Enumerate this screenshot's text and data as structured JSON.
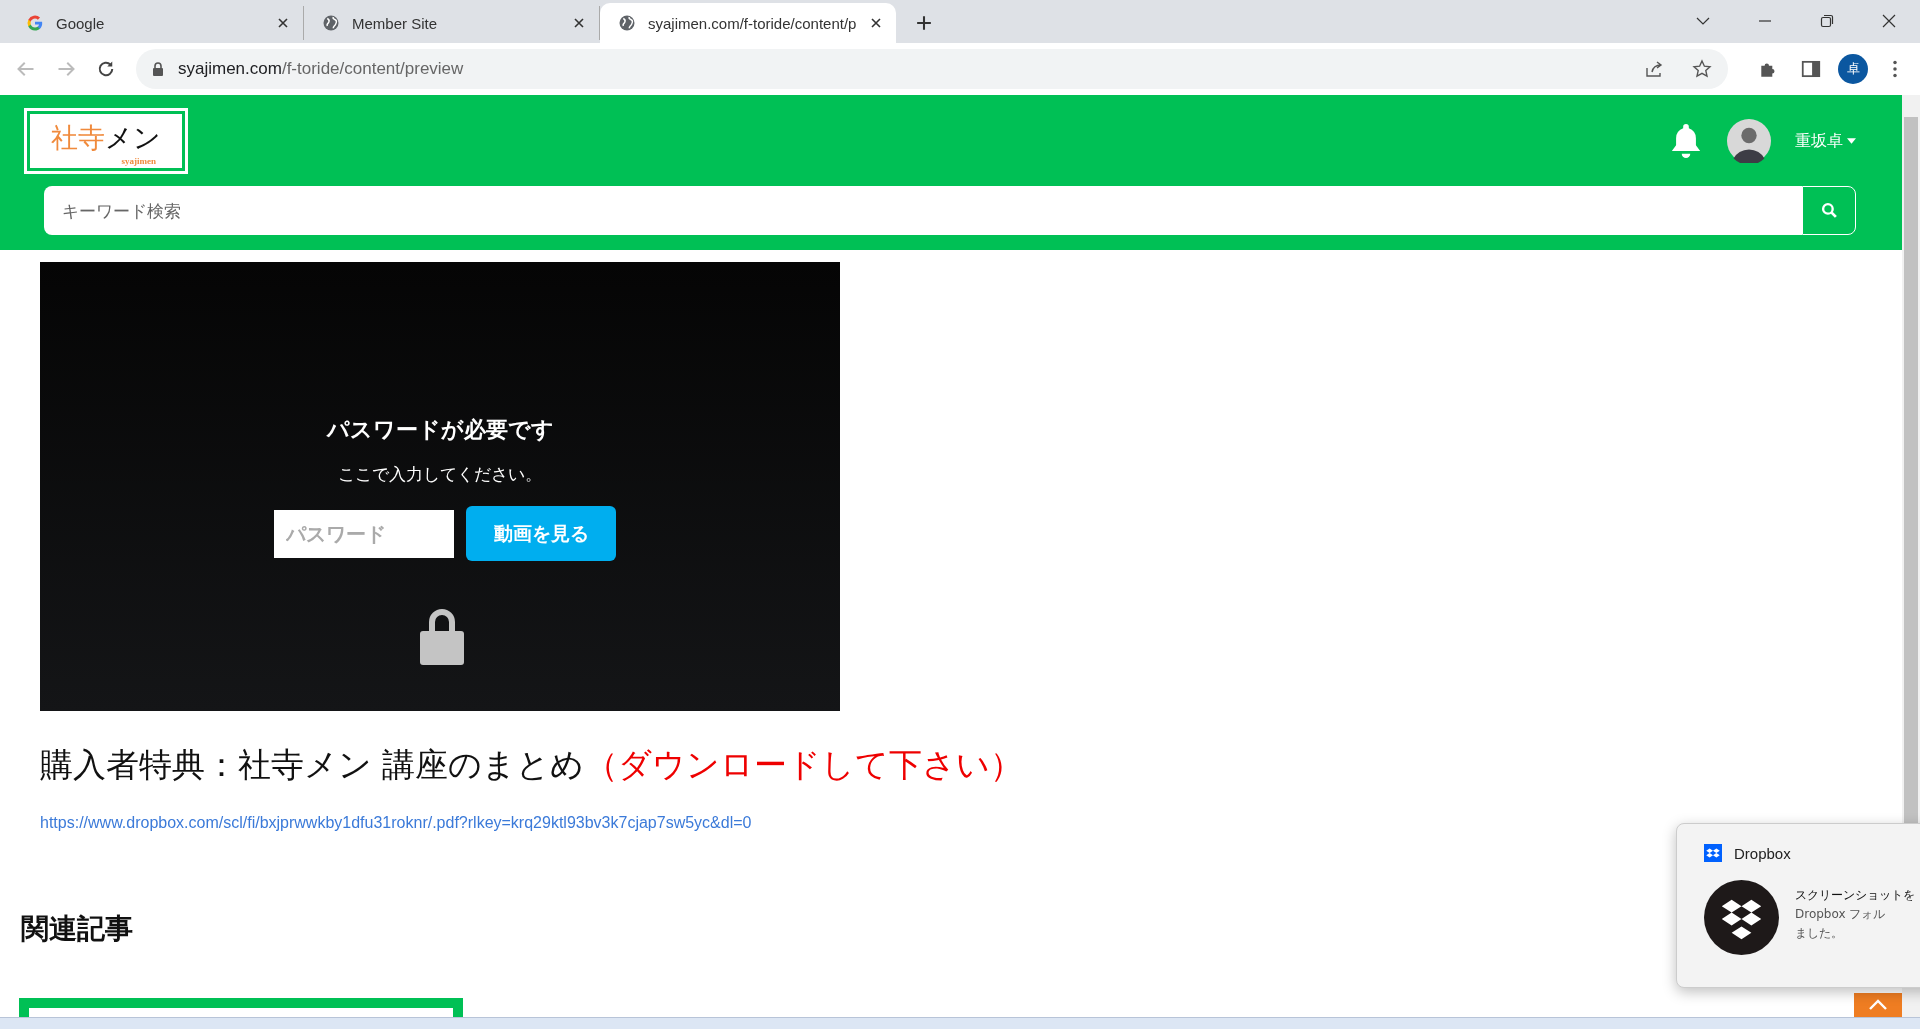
{
  "browser": {
    "tabs": [
      {
        "title": "Google",
        "kind": "google",
        "selected": false
      },
      {
        "title": "Member Site",
        "kind": "globe",
        "selected": false
      },
      {
        "title": "syajimen.com/f-toride/content/p",
        "kind": "globe",
        "selected": true
      }
    ],
    "address": {
      "domain": "syajimen.com",
      "path": "/f-toride/content/preview"
    },
    "profile_initial": "卓"
  },
  "site": {
    "logo": {
      "accent": "社寺",
      "main": "メン",
      "sub": "syajimen"
    },
    "user_name": "重坂卓",
    "search": {
      "placeholder": "キーワード検索"
    }
  },
  "video": {
    "title": "パスワードが必要です",
    "message": "ここで入力してください。",
    "password": {
      "placeholder": "パスワード"
    },
    "button": "動画を見る"
  },
  "article": {
    "title": "購入者特典：社寺メン 講座のまとめ",
    "title_note": "（ダウンロードして下さい）",
    "link": "https://www.dropbox.com/scl/fi/bxjprwwkby1dfu31roknr/.pdf?rlkey=krq29ktl93bv3k7cjap7sw5yc&dl=0",
    "related_heading": "関連記事"
  },
  "notification": {
    "app": "Dropbox",
    "lines": [
      "スクリーンショットを",
      "Dropbox フォル",
      "ました。"
    ]
  }
}
